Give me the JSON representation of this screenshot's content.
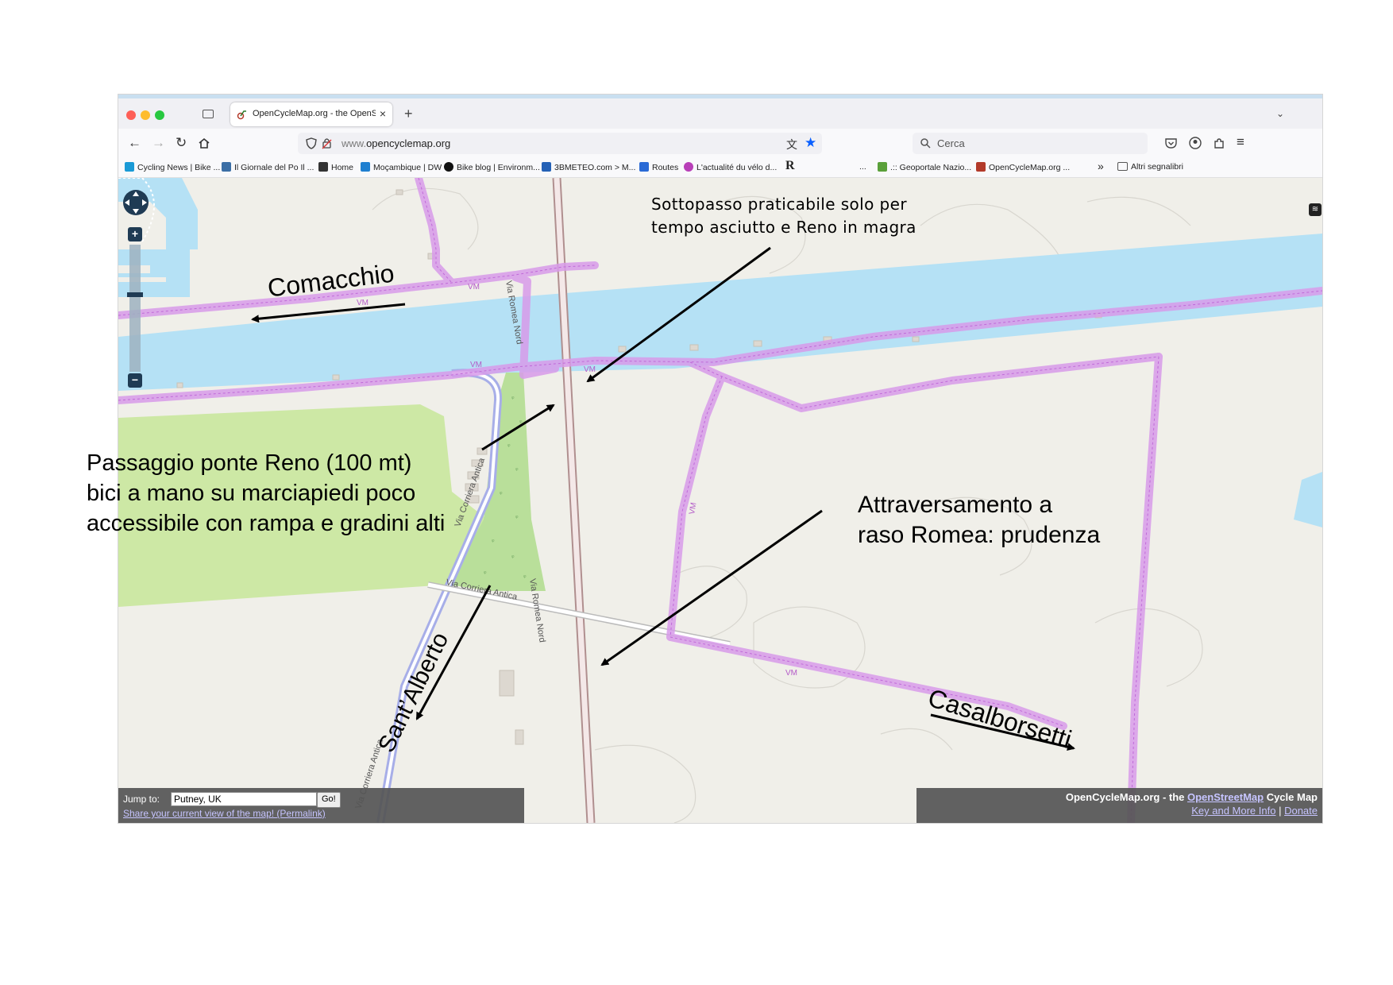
{
  "browser": {
    "tab_title": "OpenCycleMap.org - the OpenS",
    "url_domain": "opencyclemap.org",
    "url_prefix": "www.",
    "search_placeholder": "Cerca",
    "bookmarks": [
      {
        "label": "Cycling News | Bike ...",
        "color": "#1a9ad6"
      },
      {
        "label": "Il Giornale del Po Il ...",
        "color": "#3b6ea5"
      },
      {
        "label": "Home",
        "color": "#333333"
      },
      {
        "label": "Moçambique | DW",
        "color": "#1f7fd0"
      },
      {
        "label": "Bike blog | Environm...",
        "color": "#111111"
      },
      {
        "label": "3BMETEO.com > M...",
        "color": "#2461b6"
      },
      {
        "label": "Routes",
        "color": "#2a6ad6"
      },
      {
        "label": "L'actualité du vélo d...",
        "color": "#b83fb8"
      },
      {
        "label": "R",
        "color": "#000000"
      },
      {
        "label": "...",
        "color": "#777777"
      },
      {
        "label": ".:: Geoportale Nazio...",
        "color": "#5aa03a"
      },
      {
        "label": "OpenCycleMap.org ...",
        "color": "#b33a2a"
      }
    ],
    "more_bookmarks": "»",
    "other_bookmarks": "Altri segnalibri"
  },
  "map": {
    "road_labels": {
      "via_romea_nord_top": "Via Romea Nord",
      "via_romea_nord_bottom": "Via Romea Nord",
      "via_corriera_antica_1": "Via Corriera Antica",
      "via_corriera_antica_2": "Via Corriera Antica",
      "via_corriera_antica_3": "Via Corriera Antica",
      "vm": "VM"
    },
    "jump_to": {
      "label": "Jump to:",
      "value": "Putney, UK",
      "button": "Go!",
      "permalink": "Share your current view of the map! (Permalink)"
    },
    "attribution": {
      "prefix": "OpenCycleMap.org - the ",
      "osm": "OpenStreetMap",
      "suffix": " Cycle Map",
      "key": "Key and More Info",
      "sep": " | ",
      "donate": "Donate"
    },
    "colors": {
      "water": "#b5e1f5",
      "land": "#f0efe9",
      "park": "#cde8a5",
      "cycle_route": "#d89bea",
      "rail": "#9a7d7d"
    }
  },
  "annotations": {
    "sottopasso_line1": "Sottopasso praticabile solo per",
    "sottopasso_line2": "tempo asciutto e Reno in magra",
    "passaggio_line1": "Passaggio ponte Reno (100 mt)",
    "passaggio_line2": "bici a mano su marciapiedi poco",
    "passaggio_line3": "accessibile con rampa e gradini alti",
    "attraversamento_line1": "Attraversamento a",
    "attraversamento_line2": "raso Romea: prudenza",
    "comacchio": "Comacchio",
    "casalborsetti": "Casalborsetti",
    "santalberto": "Sant’Alberto"
  }
}
